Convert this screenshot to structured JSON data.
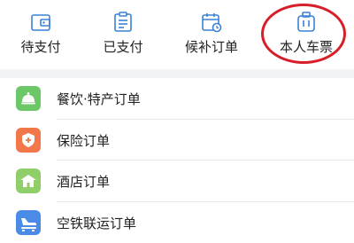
{
  "tabs": [
    {
      "label": "待支付",
      "icon": "wallet-icon"
    },
    {
      "label": "已支付",
      "icon": "paid-list-icon"
    },
    {
      "label": "候补订单",
      "icon": "waitlist-calendar-icon"
    },
    {
      "label": "本人车票",
      "icon": "luggage-ticket-icon"
    }
  ],
  "menu": [
    {
      "label": "餐饮·特产订单",
      "icon": "dining-cloche-icon",
      "color": "#6cc766"
    },
    {
      "label": "保险订单",
      "icon": "insurance-shield-icon",
      "color": "#f2784b"
    },
    {
      "label": "酒店订单",
      "icon": "hotel-icon",
      "color": "#8fce68"
    },
    {
      "label": "空铁联运订单",
      "icon": "air-rail-icon",
      "color": "#4a8be8"
    }
  ],
  "colors": {
    "icon_blue": "#3b82d6",
    "highlight_circle": "#d81e28",
    "separator": "#f2f3f5"
  }
}
